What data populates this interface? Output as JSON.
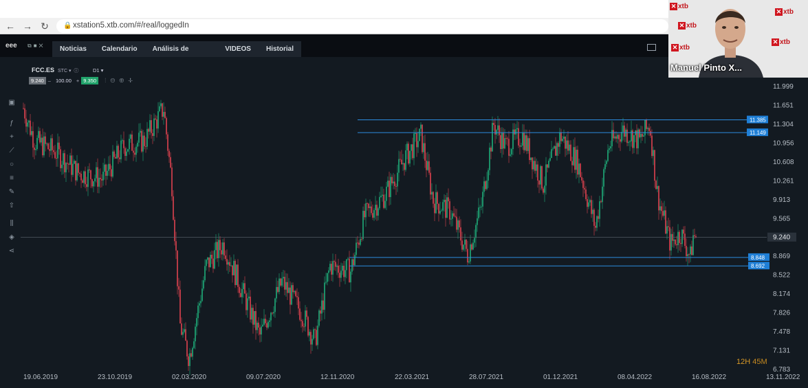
{
  "browser": {
    "url": "xstation5.xtb.com/#/real/loggedIn",
    "back_icon": "←",
    "forward_icon": "→",
    "reload_icon": "↻"
  },
  "nav": {
    "brand": "eee",
    "tabs": [
      "Noticias",
      "Calendario",
      "Análisis de mercado",
      "VIDEOS",
      "Historial"
    ]
  },
  "instrument": {
    "symbol": "FCC.ES",
    "meta": "STC",
    "timeframe": "D1",
    "sell_price": "9.240",
    "volume": "100.00",
    "buy_price": "9.350",
    "minus": "–",
    "plus": "+"
  },
  "chart": {
    "price_labels": [
      "11.999",
      "11.651",
      "11.304",
      "10.956",
      "10.608",
      "10.261",
      "9.913",
      "9.565",
      "9.240",
      "8.869",
      "8.522",
      "8.174",
      "7.826",
      "7.478",
      "7.131",
      "6.783"
    ],
    "date_labels": [
      "19.06.2019",
      "23.10.2019",
      "02.03.2020",
      "09.07.2020",
      "12.11.2020",
      "22.03.2021",
      "28.07.2021",
      "01.12.2021",
      "08.04.2022",
      "16.08.2022",
      "13.11.2022"
    ],
    "level_tags": [
      "11.385",
      "11.149",
      "8.848",
      "8.692"
    ],
    "current_price": "9.240",
    "ylim": [
      6.783,
      11.999
    ],
    "colors": {
      "up": "#1fae7a",
      "down": "#e0424f",
      "level": "#2d8de0",
      "tag_bg": "#1f7fd6"
    }
  },
  "timer": {
    "hours": "12H",
    "minutes": "45M"
  },
  "webcam": {
    "name": "Manuel Pinto X...",
    "logo_text": "xtb"
  }
}
